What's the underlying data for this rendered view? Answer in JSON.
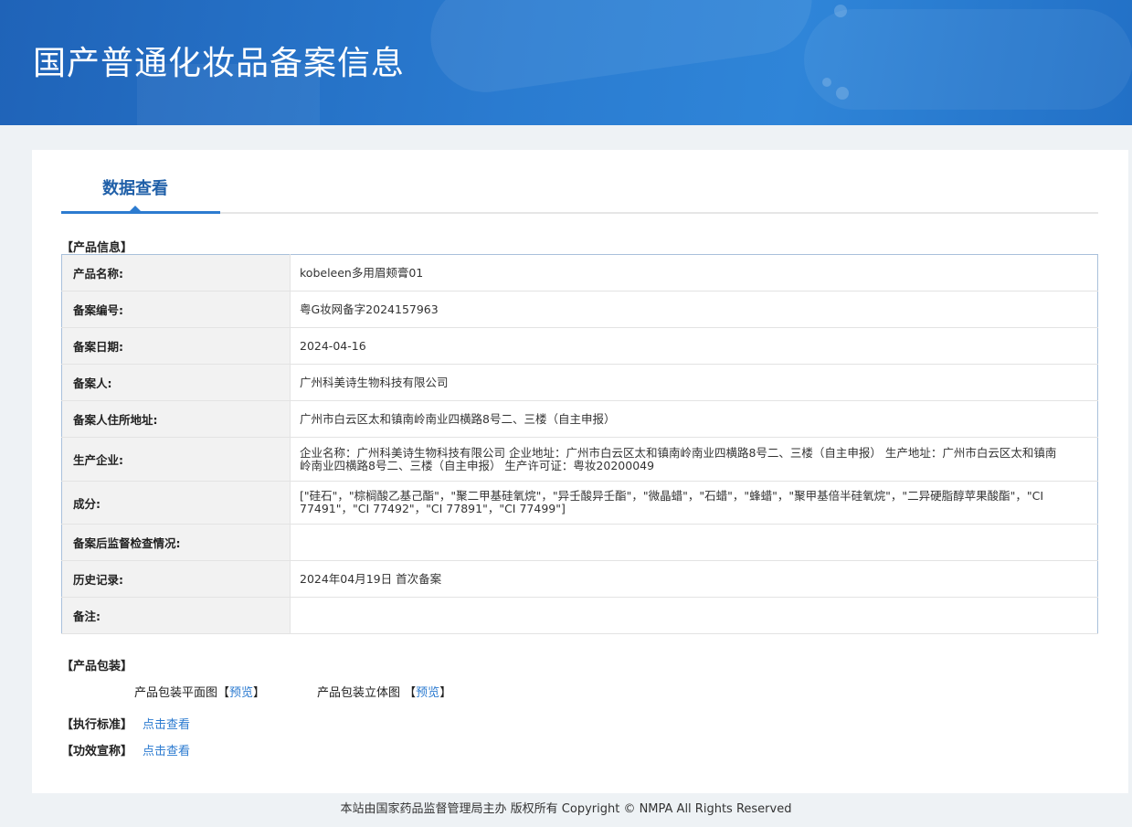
{
  "header": {
    "title": "国产普通化妆品备案信息"
  },
  "tab": {
    "label": "数据查看"
  },
  "product_section": {
    "title": "【产品信息】"
  },
  "rows": [
    {
      "label": "产品名称:",
      "value": "kobeleen多用眉颊膏01"
    },
    {
      "label": "备案编号:",
      "value": "粤G妆网备字2024157963"
    },
    {
      "label": "备案日期:",
      "value": "2024-04-16"
    },
    {
      "label": "备案人:",
      "value": "广州科美诗生物科技有限公司"
    },
    {
      "label": "备案人住所地址:",
      "value": "广州市白云区太和镇南岭南业四横路8号二、三楼（自主申报）"
    },
    {
      "label": "生产企业:",
      "value": "企业名称：广州科美诗生物科技有限公司 企业地址：广州市白云区太和镇南岭南业四横路8号二、三楼（自主申报） 生产地址：广州市白云区太和镇南岭南业四横路8号二、三楼（自主申报） 生产许可证：粤妆20200049"
    },
    {
      "label": "成分:",
      "value": "[\"硅石\"，\"棕榈酸乙基己酯\"，\"聚二甲基硅氧烷\"，\"异壬酸异壬酯\"，\"微晶蜡\"，\"石蜡\"，\"蜂蜡\"，\"聚甲基倍半硅氧烷\"，\"二异硬脂醇苹果酸酯\"，\"CI 77491\"，\"CI 77492\"，\"CI 77891\"，\"CI 77499\"]"
    },
    {
      "label": "备案后监督检查情况:",
      "value": ""
    },
    {
      "label": "历史记录:",
      "value": "2024年04月19日 首次备案"
    },
    {
      "label": "备注:",
      "value": ""
    }
  ],
  "packaging": {
    "title": "【产品包装】",
    "flat_label": "产品包装平面图",
    "flat_bracket_open": "【",
    "flat_link": "预览",
    "flat_bracket_close": "】",
    "solid_label": "产品包装立体图",
    "solid_bracket_open": "【",
    "solid_link": "预览",
    "solid_bracket_close": "】"
  },
  "standard": {
    "title": "【执行标准】",
    "link": "点击查看"
  },
  "efficacy": {
    "title": "【功效宣称】",
    "link": "点击查看"
  },
  "footer": {
    "text": "本站由国家药品监督管理局主办 版权所有 Copyright © NMPA All Rights Reserved"
  }
}
